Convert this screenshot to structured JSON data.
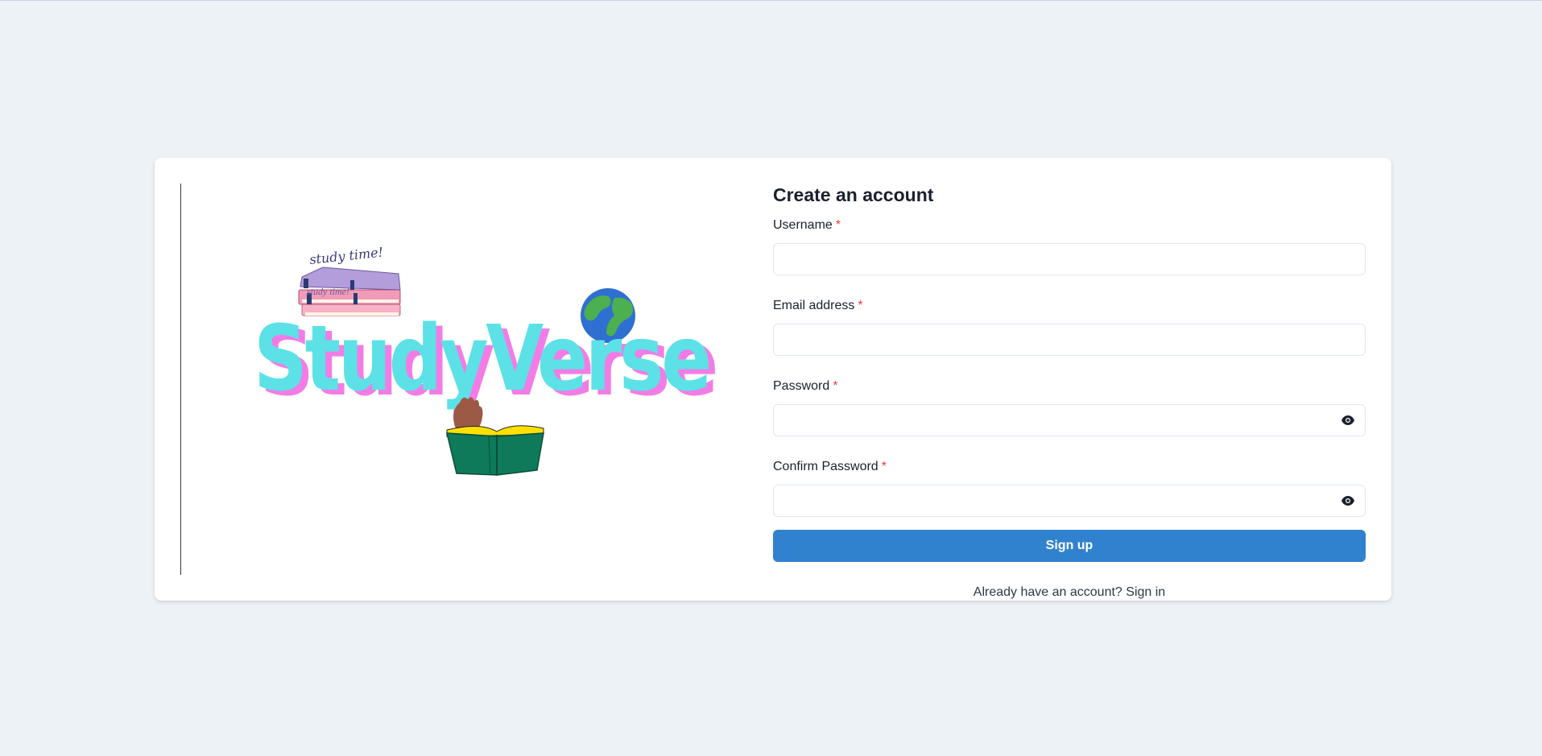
{
  "form": {
    "title": "Create an account",
    "fields": [
      {
        "label": "Username",
        "required_mark": "*",
        "value": "",
        "placeholder": "",
        "type": "text"
      },
      {
        "label": "Email address",
        "required_mark": "*",
        "value": "",
        "placeholder": "",
        "type": "email"
      },
      {
        "label": "Password",
        "required_mark": "*",
        "value": "",
        "placeholder": "",
        "type": "password",
        "toggle_icon": "eye-icon"
      },
      {
        "label": "Confirm Password",
        "required_mark": "*",
        "value": "",
        "placeholder": "",
        "type": "password",
        "toggle_icon": "eye-icon"
      }
    ],
    "submit_label": "Sign up",
    "footer_prompt": "Already have an account?",
    "footer_link": "Sign in"
  },
  "logo": {
    "wordmark": "StudyVerse",
    "tagline": "study time!",
    "icons": [
      "books-stack-icon",
      "globe-icon",
      "open-book-icon",
      "hand-icon"
    ]
  },
  "colors": {
    "page_bg": "#edf2f7",
    "card_bg": "#ffffff",
    "accent": "#3182ce",
    "required": "#e53e3e",
    "logo_primary": "#5ce1e6",
    "logo_shadow": "#f27ce6"
  }
}
